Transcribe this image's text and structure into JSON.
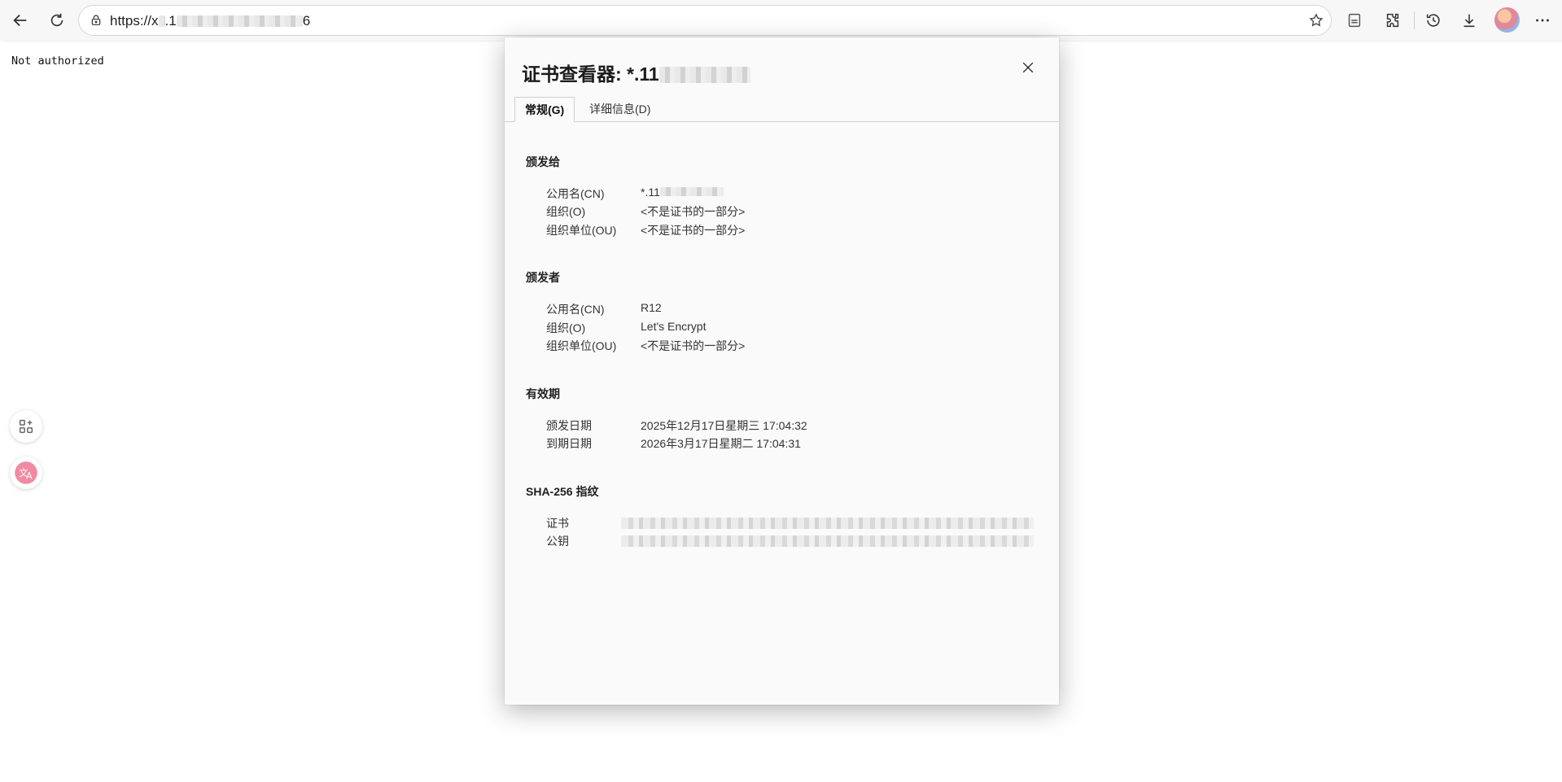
{
  "browser": {
    "url_prefix": "https://x",
    "url_mid": ".1",
    "url_suffix": "6"
  },
  "page": {
    "message": "Not authorized"
  },
  "dialog": {
    "title_prefix": "证书查看器: *.11",
    "tabs": [
      {
        "label": "常规(G)",
        "active": true
      },
      {
        "label": "详细信息(D)",
        "active": false
      }
    ],
    "issued_to": {
      "heading": "颁发给",
      "rows": [
        {
          "label": "公用名(CN)",
          "value": "*.11"
        },
        {
          "label": "组织(O)",
          "value": "<不是证书的一部分>"
        },
        {
          "label": "组织单位(OU)",
          "value": "<不是证书的一部分>"
        }
      ]
    },
    "issued_by": {
      "heading": "颁发者",
      "rows": [
        {
          "label": "公用名(CN)",
          "value": "R12"
        },
        {
          "label": "组织(O)",
          "value": "Let's Encrypt"
        },
        {
          "label": "组织单位(OU)",
          "value": "<不是证书的一部分>"
        }
      ]
    },
    "validity": {
      "heading": "有效期",
      "rows": [
        {
          "label": "颁发日期",
          "value": "2025年12月17日星期三 17:04:32"
        },
        {
          "label": "到期日期",
          "value": "2026年3月17日星期二 17:04:31"
        }
      ]
    },
    "fingerprints": {
      "heading": "SHA-256 指纹",
      "rows": [
        {
          "label": "证书"
        },
        {
          "label": "公钥"
        }
      ]
    }
  },
  "icons": {
    "back": "back-arrow-icon",
    "reload": "reload-icon",
    "lock": "lock-icon",
    "favorite": "star-icon",
    "reading": "reading-view-icon",
    "extensions": "puzzle-icon",
    "history": "history-icon",
    "downloads": "download-icon",
    "more": "more-icon",
    "close": "close-icon",
    "apps": "apps-add-icon",
    "translate": "translate-icon"
  }
}
